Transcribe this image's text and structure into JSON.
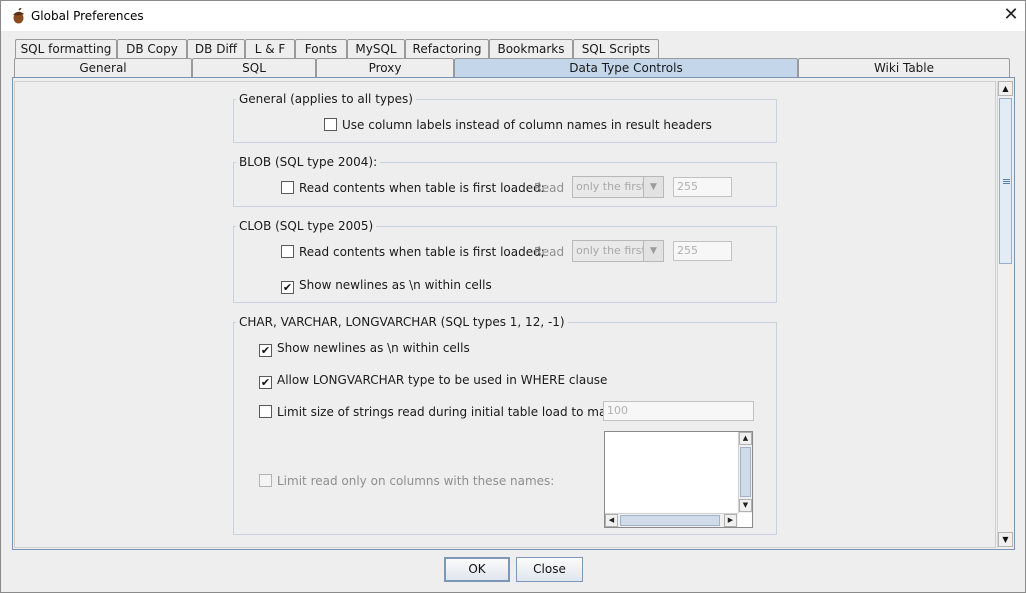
{
  "window": {
    "title": "Global Preferences"
  },
  "tabs_row1": [
    {
      "label": "SQL formatting"
    },
    {
      "label": "DB Copy"
    },
    {
      "label": "DB Diff"
    },
    {
      "label": "L & F"
    },
    {
      "label": "Fonts"
    },
    {
      "label": "MySQL"
    },
    {
      "label": "Refactoring"
    },
    {
      "label": "Bookmarks"
    },
    {
      "label": "SQL Scripts"
    }
  ],
  "tabs_row2": [
    {
      "label": "General"
    },
    {
      "label": "SQL"
    },
    {
      "label": "Proxy"
    },
    {
      "label": "Data Type Controls",
      "selected": true
    },
    {
      "label": "Wiki Table"
    }
  ],
  "general_group": {
    "title": "General (applies to all types)",
    "use_column_labels": {
      "label": "Use column labels instead of column names in result headers",
      "checked": false
    }
  },
  "blob_group": {
    "title": "BLOB  (SQL type 2004):",
    "read_contents": {
      "label": "Read contents when table is first loaded:",
      "checked": false
    },
    "read_label": "Read",
    "read_mode": "only the first",
    "read_size": "255"
  },
  "clob_group": {
    "title": "CLOB  (SQL type 2005)",
    "read_contents": {
      "label": "Read contents when table is first loaded;",
      "checked": false
    },
    "read_label": "Read",
    "read_mode": "only the first",
    "read_size": "255",
    "show_newlines": {
      "label": "Show newlines as \\n within cells",
      "checked": true
    }
  },
  "char_group": {
    "title": "CHAR, VARCHAR, LONGVARCHAR  (SQL types 1, 12, -1)",
    "show_newlines": {
      "label": "Show newlines as \\n within cells",
      "checked": true
    },
    "allow_longvarchar": {
      "label": "Allow LONGVARCHAR type to be used in WHERE clause",
      "checked": true
    },
    "limit_size": {
      "label": "Limit size of strings read during initial table load to max of:",
      "checked": false
    },
    "limit_size_value": "100",
    "limit_columns": {
      "label": "Limit read only on columns with these names:",
      "checked": false
    }
  },
  "buttons": {
    "ok": "OK",
    "close": "Close"
  },
  "colors": {
    "selected_tab": "#c3d6ea",
    "border_accent": "#7a94b4"
  },
  "icons": {
    "app": "acorn-icon",
    "close": "close-icon",
    "check": "checkmark-icon"
  }
}
